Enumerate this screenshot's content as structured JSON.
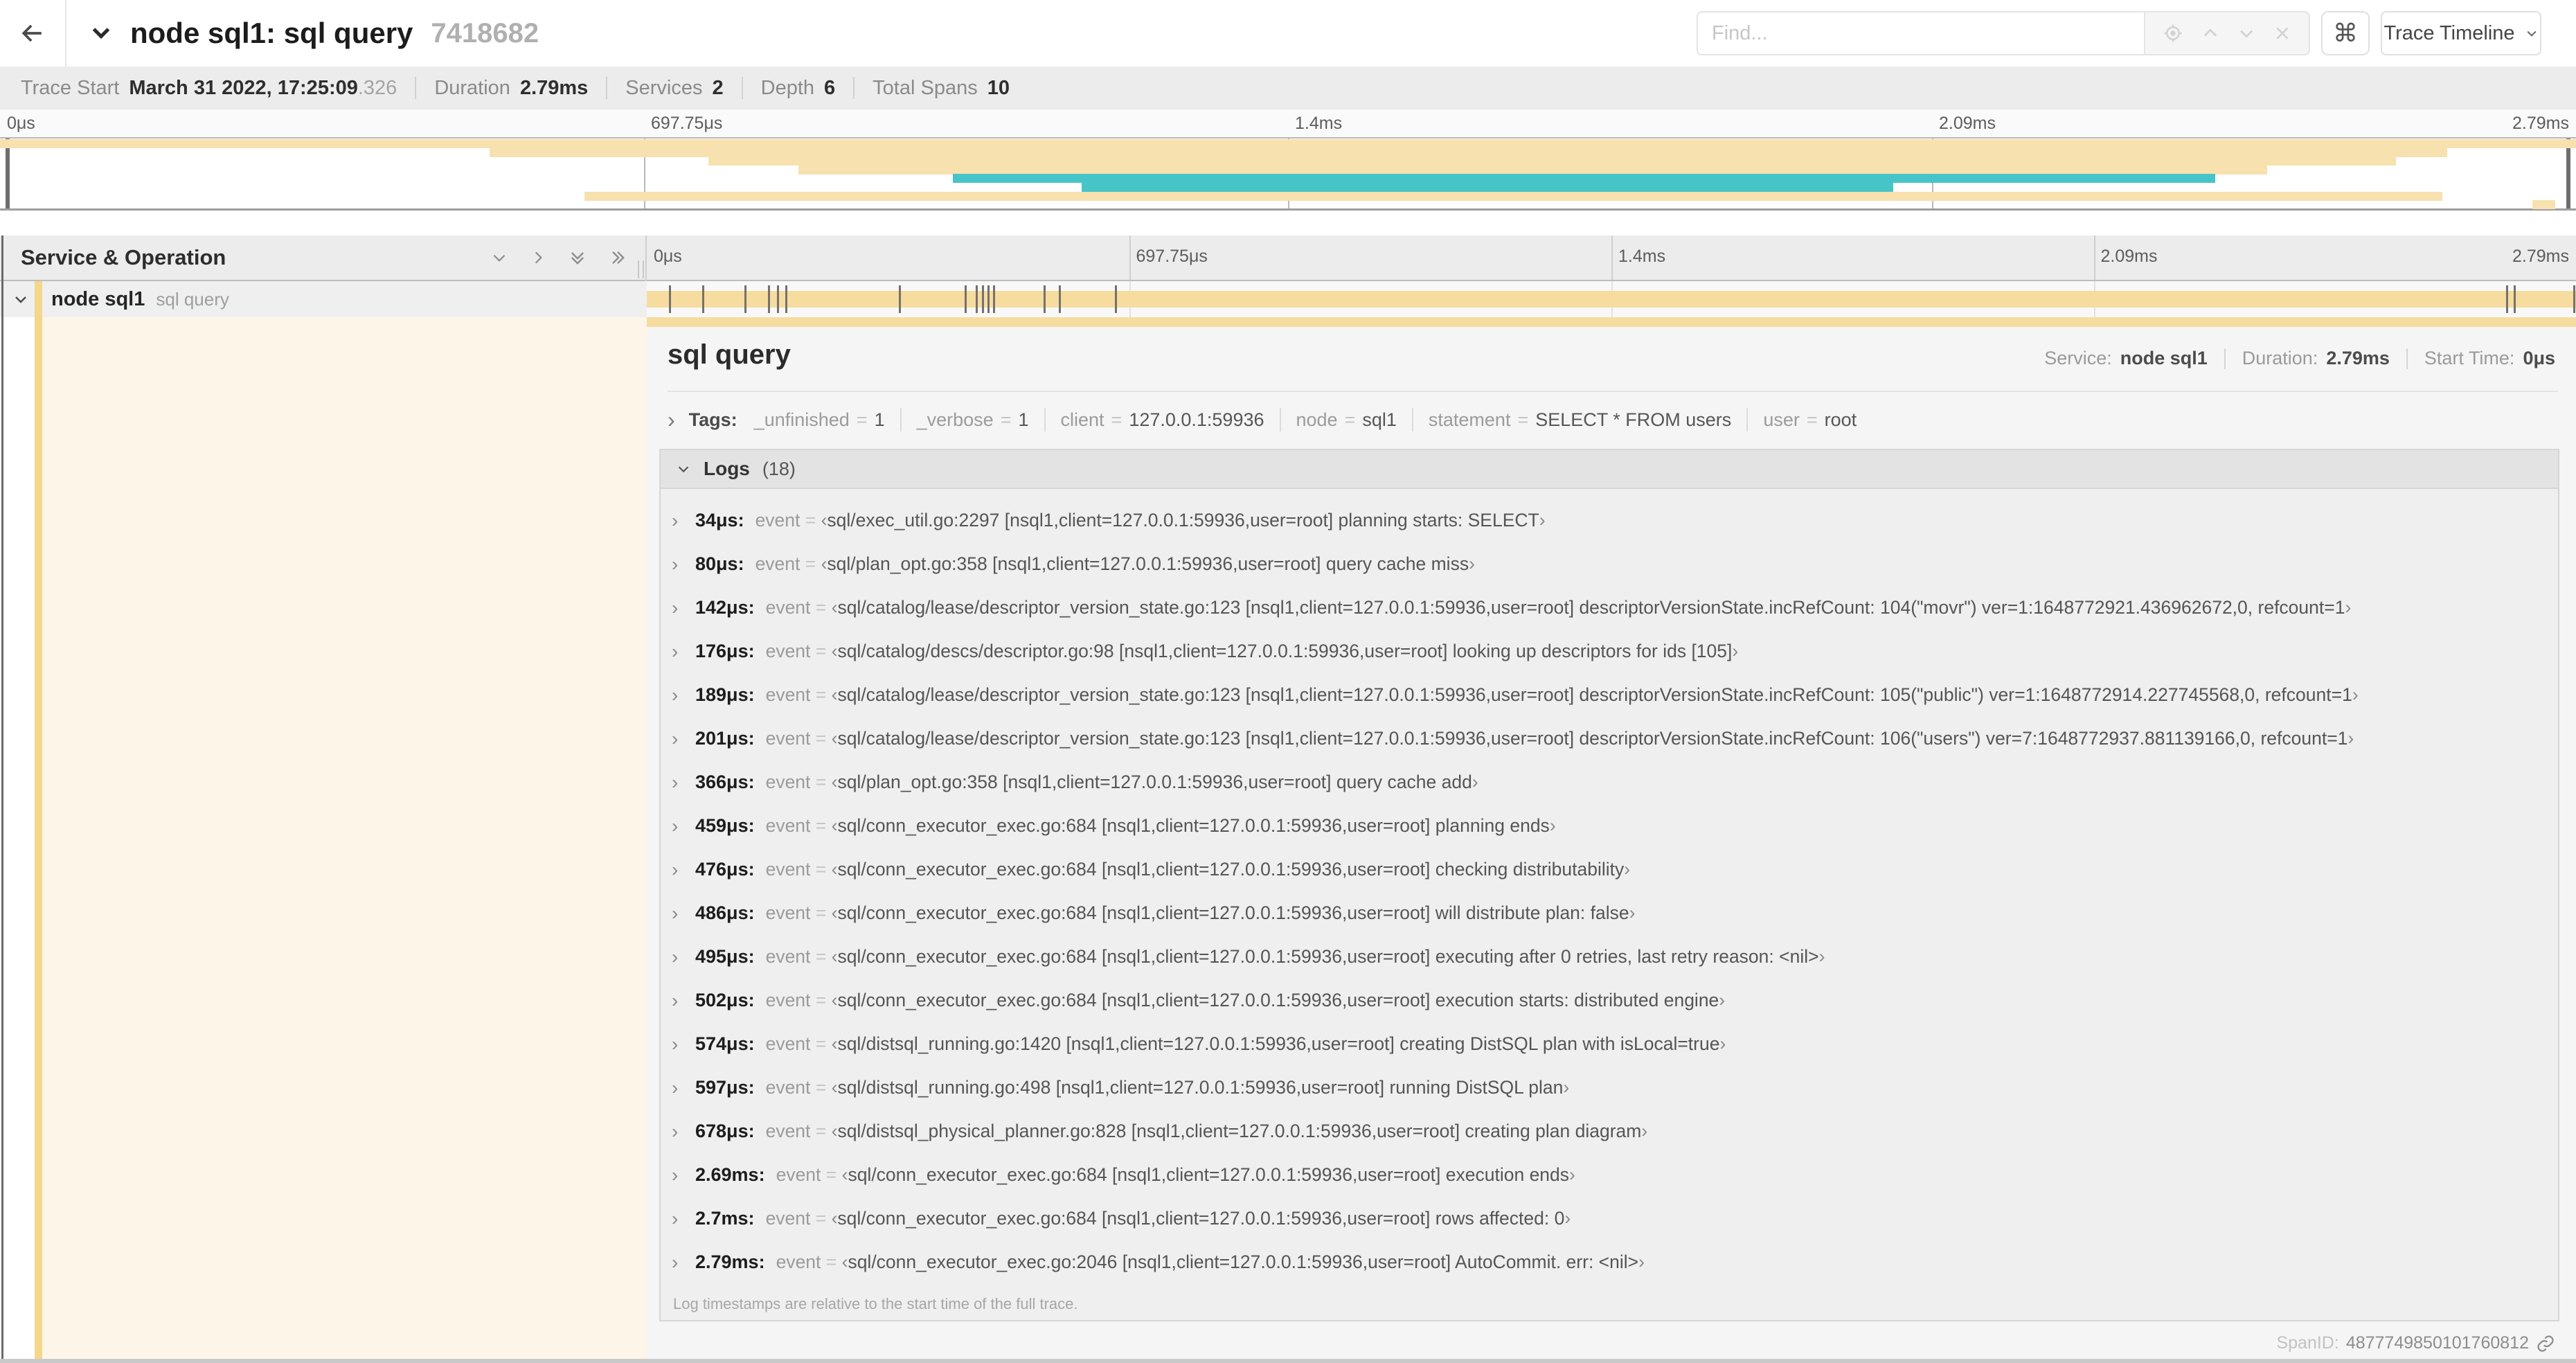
{
  "colors": {
    "bar": "#f7dca0",
    "bar_minimap": "#f7e1ae",
    "teal": "#46c5c8",
    "accent": "#f3d78a",
    "cream": "#fdf5e8",
    "marker": "#76716b"
  },
  "header": {
    "title": "node sql1: sql query",
    "trace_id": "7418682",
    "find_placeholder": "Find...",
    "shortcut_key": "⌘",
    "view_button": "Trace Timeline"
  },
  "summary": {
    "items": [
      {
        "label": "Trace Start",
        "value": "March 31 2022, 17:25:09",
        "suffix": ".326"
      },
      {
        "label": "Duration",
        "value": "2.79ms"
      },
      {
        "label": "Services",
        "value": "2"
      },
      {
        "label": "Depth",
        "value": "6"
      },
      {
        "label": "Total Spans",
        "value": "10"
      }
    ]
  },
  "timeline": {
    "axis_ticks": [
      "0μs",
      "697.75μs",
      "1.4ms",
      "2.09ms",
      "2.79ms"
    ],
    "columns_header": "Service & Operation",
    "minimap_rows": [
      {
        "start": 0,
        "end": 100,
        "color": "tan"
      },
      {
        "start": 19,
        "end": 95,
        "color": "tan"
      },
      {
        "start": 27.5,
        "end": 93,
        "color": "tan"
      },
      {
        "start": 31,
        "end": 88,
        "color": "tan"
      },
      {
        "start": 37,
        "end": 86,
        "color": "teal"
      },
      {
        "start": 42,
        "end": 73.5,
        "color": "teal"
      },
      {
        "start": 22.7,
        "end": 94.8,
        "color": "tan"
      },
      {
        "start": 98.3,
        "end": 99.2,
        "color": "tan"
      }
    ],
    "row": {
      "service": "node sql1",
      "operation": "sql query",
      "bar_start": 0,
      "bar_end": 100,
      "markers": [
        1.2,
        2.9,
        5.1,
        6.3,
        6.8,
        7.2,
        13.1,
        16.5,
        17.1,
        17.4,
        17.7,
        18,
        20.6,
        21.4,
        24.3,
        96.4,
        96.8,
        99.9
      ]
    }
  },
  "detail": {
    "title": "sql query",
    "overview": [
      {
        "label": "Service:",
        "value": "node sql1"
      },
      {
        "label": "Duration:",
        "value": "2.79ms"
      },
      {
        "label": "Start Time:",
        "value": "0μs"
      }
    ],
    "tags_label": "Tags:",
    "tags": [
      {
        "key": "_unfinished",
        "value": "1"
      },
      {
        "key": "_verbose",
        "value": "1"
      },
      {
        "key": "client",
        "value": "127.0.0.1:59936"
      },
      {
        "key": "node",
        "value": "sql1"
      },
      {
        "key": "statement",
        "value": "SELECT * FROM users"
      },
      {
        "key": "user",
        "value": "root"
      }
    ],
    "logs": {
      "label": "Logs",
      "count": "(18)",
      "field": "event",
      "entries": [
        {
          "time": "34μs",
          "value": "sql/exec_util.go:2297 [nsql1,client=127.0.0.1:59936,user=root] planning starts: SELECT"
        },
        {
          "time": "80μs",
          "value": "sql/plan_opt.go:358 [nsql1,client=127.0.0.1:59936,user=root] query cache miss"
        },
        {
          "time": "142μs",
          "value": "sql/catalog/lease/descriptor_version_state.go:123 [nsql1,client=127.0.0.1:59936,user=root] descriptorVersionState.incRefCount: 104(\"movr\") ver=1:1648772921.436962672,0, refcount=1"
        },
        {
          "time": "176μs",
          "value": "sql/catalog/descs/descriptor.go:98 [nsql1,client=127.0.0.1:59936,user=root] looking up descriptors for ids [105]"
        },
        {
          "time": "189μs",
          "value": "sql/catalog/lease/descriptor_version_state.go:123 [nsql1,client=127.0.0.1:59936,user=root] descriptorVersionState.incRefCount: 105(\"public\") ver=1:1648772914.227745568,0, refcount=1"
        },
        {
          "time": "201μs",
          "value": "sql/catalog/lease/descriptor_version_state.go:123 [nsql1,client=127.0.0.1:59936,user=root] descriptorVersionState.incRefCount: 106(\"users\") ver=7:1648772937.881139166,0, refcount=1"
        },
        {
          "time": "366μs",
          "value": "sql/plan_opt.go:358 [nsql1,client=127.0.0.1:59936,user=root] query cache add"
        },
        {
          "time": "459μs",
          "value": "sql/conn_executor_exec.go:684 [nsql1,client=127.0.0.1:59936,user=root] planning ends"
        },
        {
          "time": "476μs",
          "value": "sql/conn_executor_exec.go:684 [nsql1,client=127.0.0.1:59936,user=root] checking distributability"
        },
        {
          "time": "486μs",
          "value": "sql/conn_executor_exec.go:684 [nsql1,client=127.0.0.1:59936,user=root] will distribute plan: false"
        },
        {
          "time": "495μs",
          "value": "sql/conn_executor_exec.go:684 [nsql1,client=127.0.0.1:59936,user=root] executing after 0 retries, last retry reason: <nil>"
        },
        {
          "time": "502μs",
          "value": "sql/conn_executor_exec.go:684 [nsql1,client=127.0.0.1:59936,user=root] execution starts: distributed engine"
        },
        {
          "time": "574μs",
          "value": "sql/distsql_running.go:1420 [nsql1,client=127.0.0.1:59936,user=root] creating DistSQL plan with isLocal=true"
        },
        {
          "time": "597μs",
          "value": "sql/distsql_running.go:498 [nsql1,client=127.0.0.1:59936,user=root] running DistSQL plan"
        },
        {
          "time": "678μs",
          "value": "sql/distsql_physical_planner.go:828 [nsql1,client=127.0.0.1:59936,user=root] creating plan diagram"
        },
        {
          "time": "2.69ms",
          "value": "sql/conn_executor_exec.go:684 [nsql1,client=127.0.0.1:59936,user=root] execution ends"
        },
        {
          "time": "2.7ms",
          "value": "sql/conn_executor_exec.go:684 [nsql1,client=127.0.0.1:59936,user=root] rows affected: 0"
        },
        {
          "time": "2.79ms",
          "value": "sql/conn_executor_exec.go:2046 [nsql1,client=127.0.0.1:59936,user=root] AutoCommit. err: <nil>"
        }
      ],
      "footnote": "Log timestamps are relative to the start time of the full trace."
    },
    "span_id_label": "SpanID:",
    "span_id": "4877749850101760812"
  }
}
